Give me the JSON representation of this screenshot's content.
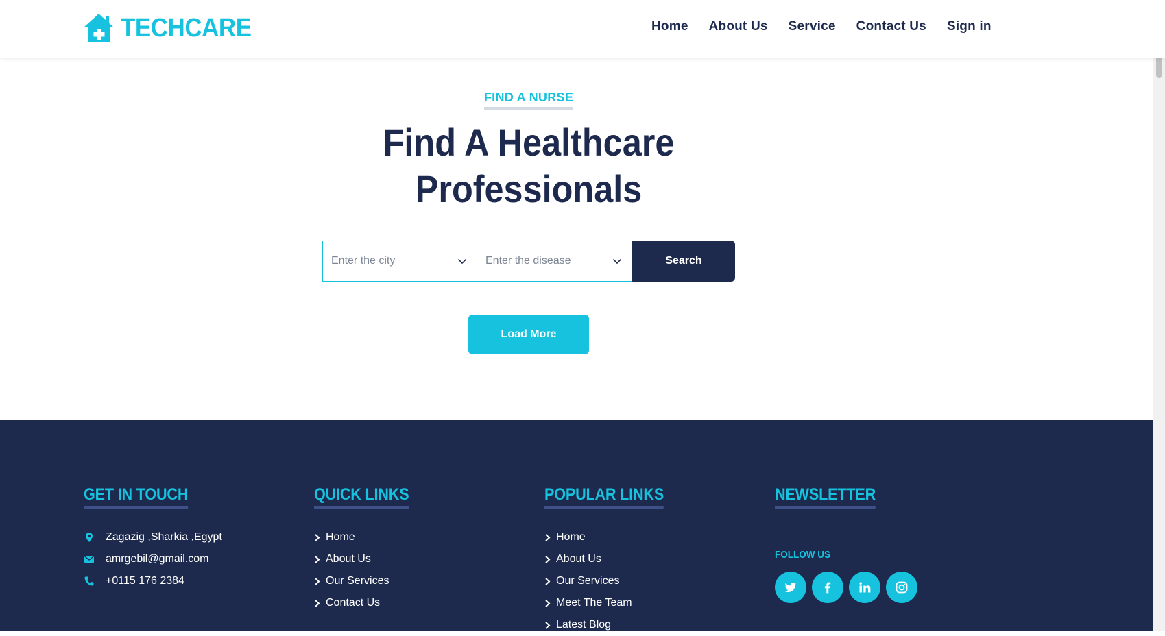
{
  "brand": {
    "name": "TECHCARE",
    "icon": "house-medical-icon"
  },
  "nav": {
    "items": [
      {
        "label": "Home"
      },
      {
        "label": "About Us"
      },
      {
        "label": "Service"
      },
      {
        "label": "Contact Us"
      },
      {
        "label": "Sign in"
      }
    ]
  },
  "hero": {
    "eyebrow": "FIND A NURSE",
    "title_line1": "Find A Healthcare",
    "title_line2": "Professionals",
    "city_placeholder": "Enter the city",
    "disease_placeholder": "Enter the disease",
    "search_label": "Search",
    "load_more_label": "Load More"
  },
  "footer": {
    "get_in_touch": {
      "title": "GET IN TOUCH",
      "address": "Zagazig ,Sharkia ,Egypt",
      "email": "amrgebil@gmail.com",
      "phone": "+0115 176 2384"
    },
    "quick_links": {
      "title": "QUICK LINKS",
      "items": [
        "Home",
        "About Us",
        "Our Services",
        "Contact Us"
      ]
    },
    "popular_links": {
      "title": "POPULAR LINKS",
      "items": [
        "Home",
        "About Us",
        "Our Services",
        "Meet The Team",
        "Latest Blog"
      ]
    },
    "newsletter": {
      "title": "NEWSLETTER",
      "follow_label": "FOLLOW US",
      "socials": [
        "twitter-icon",
        "facebook-icon",
        "linkedin-icon",
        "instagram-icon"
      ]
    }
  },
  "colors": {
    "accent": "#16c2de",
    "navy": "#1d2a4d",
    "footer_bg": "#1d2a4d"
  }
}
